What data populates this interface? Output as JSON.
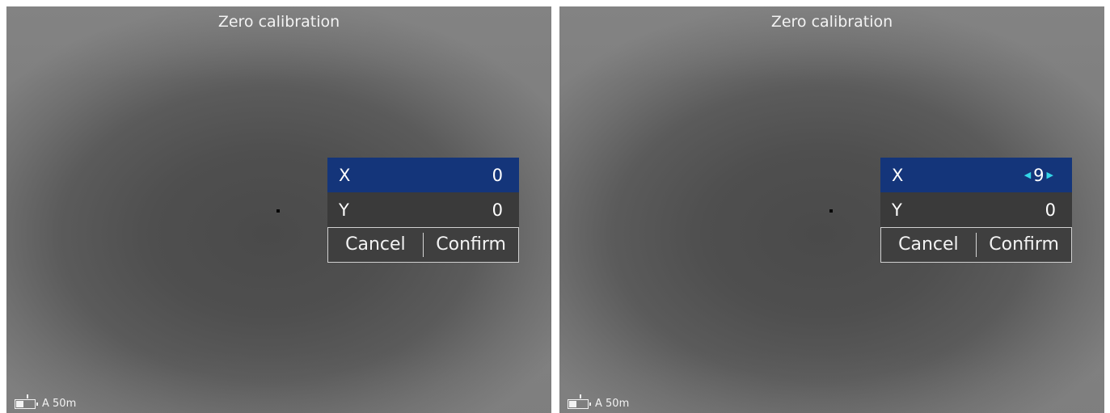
{
  "screens": [
    {
      "title": "Zero calibration",
      "menu": {
        "x_label": "X",
        "x_value": "0",
        "y_label": "Y",
        "y_value": "0",
        "cancel_label": "Cancel",
        "confirm_label": "Confirm",
        "x_editing": false
      },
      "status": {
        "battery_level": 0.35,
        "range_text": "A 50m"
      }
    },
    {
      "title": "Zero calibration",
      "menu": {
        "x_label": "X",
        "x_value": "9",
        "y_label": "Y",
        "y_value": "0",
        "cancel_label": "Cancel",
        "confirm_label": "Confirm",
        "x_editing": true
      },
      "status": {
        "battery_level": 0.35,
        "range_text": "A 50m"
      }
    }
  ],
  "icons": {
    "decrease": "left-triangle-icon",
    "increase": "right-triangle-icon",
    "battery": "battery-icon",
    "reticle": "reticle-dot-icon"
  },
  "colors": {
    "selected_row": "#14357a",
    "edit_arrows": "#33d6e8"
  }
}
